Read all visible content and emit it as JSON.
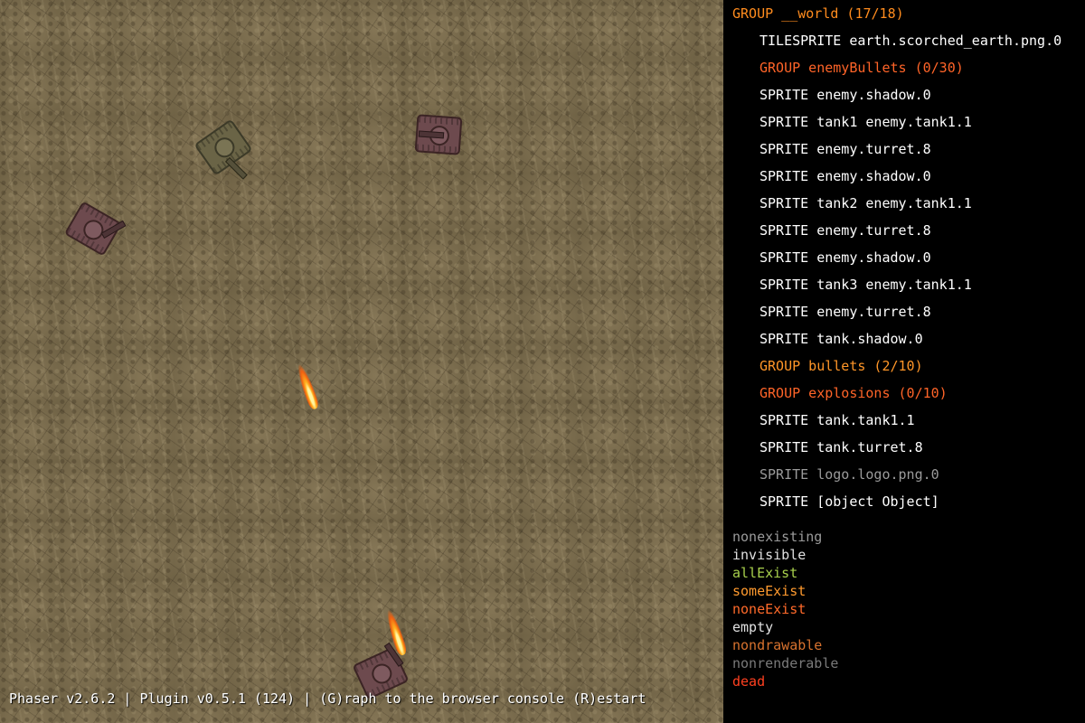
{
  "status_bar": {
    "text": "Phaser v2.6.2 | Plugin v0.5.1 (124) | (G)raph to the browser console (R)estart"
  },
  "scene_tree": [
    {
      "text": "GROUP __world (17/18)",
      "kind": "group-root",
      "depth": 0
    },
    {
      "text": "TILESPRITE earth.scorched_earth.png.0",
      "kind": "tilesprite",
      "depth": 1
    },
    {
      "text": "GROUP enemyBullets (0/30)",
      "kind": "group",
      "depth": 1
    },
    {
      "text": "SPRITE enemy.shadow.0",
      "kind": "sprite",
      "depth": 1
    },
    {
      "text": "SPRITE tank1 enemy.tank1.1",
      "kind": "sprite",
      "depth": 1
    },
    {
      "text": "SPRITE enemy.turret.8",
      "kind": "sprite",
      "depth": 1
    },
    {
      "text": "SPRITE enemy.shadow.0",
      "kind": "sprite",
      "depth": 1
    },
    {
      "text": "SPRITE tank2 enemy.tank1.1",
      "kind": "sprite",
      "depth": 1
    },
    {
      "text": "SPRITE enemy.turret.8",
      "kind": "sprite",
      "depth": 1
    },
    {
      "text": "SPRITE enemy.shadow.0",
      "kind": "sprite",
      "depth": 1
    },
    {
      "text": "SPRITE tank3 enemy.tank1.1",
      "kind": "sprite",
      "depth": 1
    },
    {
      "text": "SPRITE enemy.turret.8",
      "kind": "sprite",
      "depth": 1
    },
    {
      "text": "SPRITE tank.shadow.0",
      "kind": "sprite",
      "depth": 1
    },
    {
      "text": "GROUP bullets (2/10)",
      "kind": "group-bullets",
      "depth": 1
    },
    {
      "text": "GROUP explosions (0/10)",
      "kind": "group",
      "depth": 1
    },
    {
      "text": "SPRITE tank.tank1.1",
      "kind": "sprite",
      "depth": 1
    },
    {
      "text": "SPRITE tank.turret.8",
      "kind": "sprite",
      "depth": 1
    },
    {
      "text": "SPRITE logo.logo.png.0",
      "kind": "invisible",
      "depth": 1
    },
    {
      "text": "SPRITE [object Object]",
      "kind": "sprite",
      "depth": 1
    }
  ],
  "legend": [
    {
      "label": "nonexisting",
      "key": "nonexisting",
      "color": "#9a9a9a"
    },
    {
      "label": "invisible",
      "key": "invisible",
      "color": "#e0e0e0"
    },
    {
      "label": "allExist",
      "key": "allExist",
      "color": "#a8d04c"
    },
    {
      "label": "someExist",
      "key": "someExist",
      "color": "#ff9a2e"
    },
    {
      "label": "noneExist",
      "key": "noneExist",
      "color": "#ff6a2a"
    },
    {
      "label": "empty",
      "key": "empty",
      "color": "#e0e0e0"
    },
    {
      "label": "nondrawable",
      "key": "nondrawable",
      "color": "#d8722e"
    },
    {
      "label": "nonrenderable",
      "key": "nonrenderable",
      "color": "#7a7a7a"
    },
    {
      "label": "dead",
      "key": "dead",
      "color": "#ff4020"
    }
  ],
  "colors": {
    "ground": "#7d6e50",
    "enemy_tank": "#6d4a4e",
    "player_tank": "#6a6446",
    "bullet": "#ff9020",
    "panel_bg": "#000000"
  }
}
